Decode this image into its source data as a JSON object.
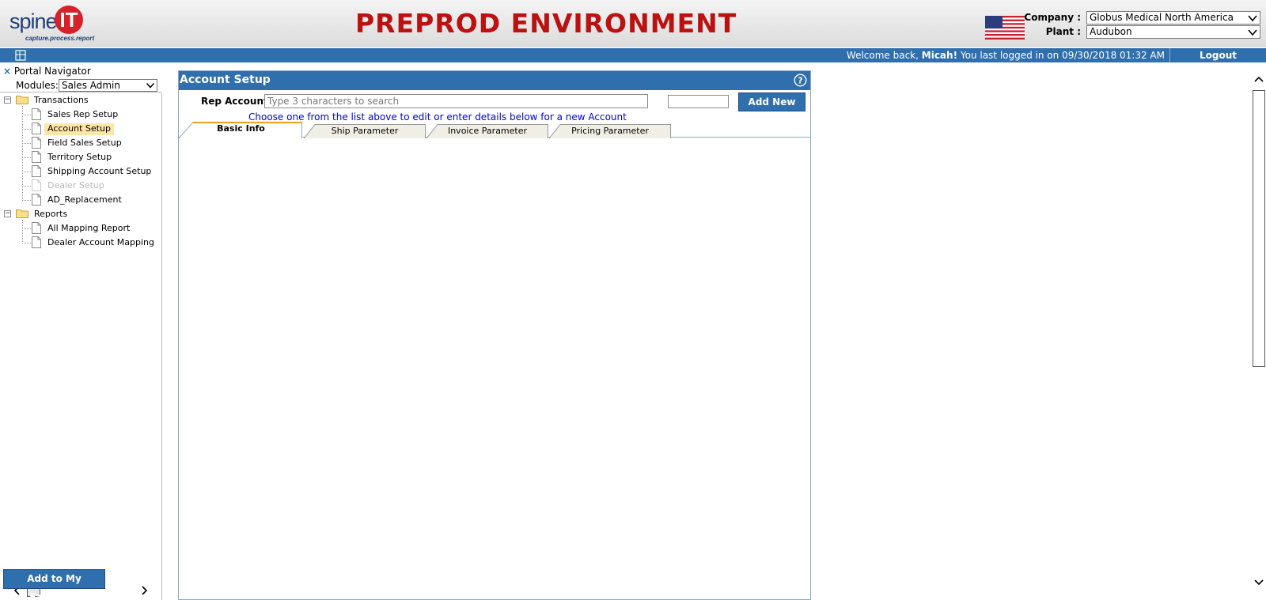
{
  "header": {
    "logo_word": "spine",
    "logo_mark": "IT",
    "logo_tagline": "capture.process.report",
    "environment_title": "PREPROD ENVIRONMENT",
    "company_label": "Company :",
    "company_value": "Globus Medical North America",
    "plant_label": "Plant :",
    "plant_value": "Audubon",
    "flag_icon": "us-flag-icon"
  },
  "topbar": {
    "welcome_prefix": "Welcome back, ",
    "user_name": "Micah!",
    "welcome_suffix": " You last logged in on 09/30/2018 01:32 AM",
    "logout_label": "Logout",
    "accent": "#2f6fad"
  },
  "navigator": {
    "close_symbol": "×",
    "title": "Portal Navigator",
    "modules_label": "Modules:",
    "modules_value": "Sales Admin",
    "folders": [
      {
        "label": "Transactions",
        "toggle": "⊟",
        "items": [
          {
            "label": "Sales Rep Setup",
            "state": "normal"
          },
          {
            "label": "Account Setup",
            "state": "selected"
          },
          {
            "label": "Field Sales Setup",
            "state": "normal"
          },
          {
            "label": "Territory Setup",
            "state": "normal"
          },
          {
            "label": "Shipping Account Setup",
            "state": "normal"
          },
          {
            "label": "Dealer Setup",
            "state": "disabled"
          },
          {
            "label": "AD_Replacement",
            "state": "normal"
          }
        ]
      },
      {
        "label": "Reports",
        "toggle": "⊟",
        "items": [
          {
            "label": "All Mapping Report",
            "state": "normal"
          },
          {
            "label": "Dealer Account Mapping",
            "state": "normal"
          }
        ]
      }
    ],
    "favorites_button": "Add to My Favorites"
  },
  "panel": {
    "title": "Account Setup",
    "help_icon": "help-icon",
    "rep_account_label": "Rep Account:",
    "rep_account_placeholder": "Type 3 characters to search",
    "rep_account_value": "",
    "add_new_label": "Add New",
    "hint": "Choose one from the list above to edit or enter details below for a new Account",
    "tabs": [
      {
        "label": "Basic Info",
        "active": true
      },
      {
        "label": "Ship Parameter",
        "active": false
      },
      {
        "label": "Invoice Parameter",
        "active": false
      },
      {
        "label": "Pricing Parameter",
        "active": false
      }
    ]
  }
}
